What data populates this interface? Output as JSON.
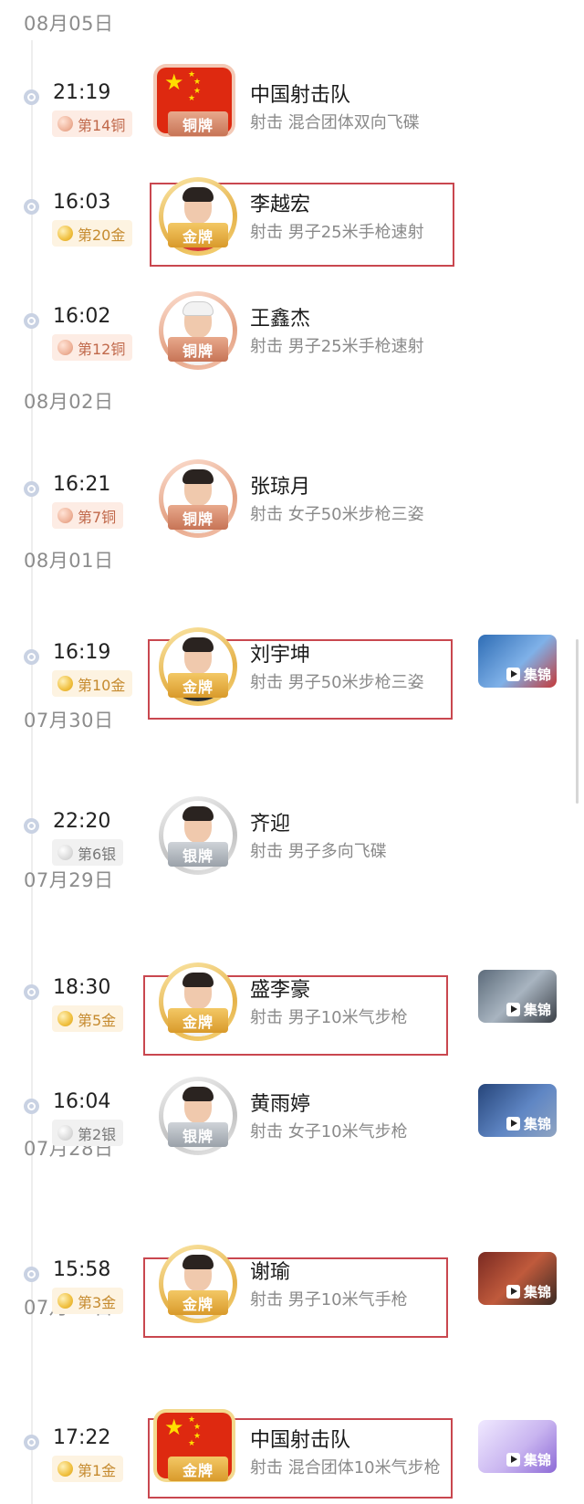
{
  "dates": [
    "08月05日",
    "08月02日",
    "08月01日",
    "07月30日",
    "07月29日",
    "07月28日",
    "07月27日"
  ],
  "entries": [
    {
      "time": "21:19",
      "badge": "第14铜",
      "badge_type": "bronze",
      "medal": "铜牌",
      "name": "中国射击队",
      "event": "射击 混合团体双向飞碟",
      "avatar": "china-flag",
      "video": null
    },
    {
      "time": "16:03",
      "badge": "第20金",
      "badge_type": "gold",
      "medal": "金牌",
      "name": "李越宏",
      "event": "射击 男子25米手枪速射",
      "avatar": "athlete-photo",
      "video": null
    },
    {
      "time": "16:02",
      "badge": "第12铜",
      "badge_type": "bronze",
      "medal": "铜牌",
      "name": "王鑫杰",
      "event": "射击 男子25米手枪速射",
      "avatar": "athlete-photo",
      "video": null
    },
    {
      "time": "16:21",
      "badge": "第7铜",
      "badge_type": "bronze",
      "medal": "铜牌",
      "name": "张琼月",
      "event": "射击 女子50米步枪三姿",
      "avatar": "athlete-photo",
      "video": null
    },
    {
      "time": "16:19",
      "badge": "第10金",
      "badge_type": "gold",
      "medal": "金牌",
      "name": "刘宇坤",
      "event": "射击 男子50米步枪三姿",
      "avatar": "athlete-photo",
      "video": "集锦"
    },
    {
      "time": "22:20",
      "badge": "第6银",
      "badge_type": "silver",
      "medal": "银牌",
      "name": "齐迎",
      "event": "射击 男子多向飞碟",
      "avatar": "athlete-photo",
      "video": null
    },
    {
      "time": "18:30",
      "badge": "第5金",
      "badge_type": "gold",
      "medal": "金牌",
      "name": "盛李豪",
      "event": "射击 男子10米气步枪",
      "avatar": "athlete-photo",
      "video": "集锦"
    },
    {
      "time": "16:04",
      "badge": "第2银",
      "badge_type": "silver",
      "medal": "银牌",
      "name": "黄雨婷",
      "event": "射击 女子10米气步枪",
      "avatar": "athlete-photo",
      "video": "集锦"
    },
    {
      "time": "15:58",
      "badge": "第3金",
      "badge_type": "gold",
      "medal": "金牌",
      "name": "谢瑜",
      "event": "射击 男子10米气手枪",
      "avatar": "athlete-photo",
      "video": "集锦"
    },
    {
      "time": "17:22",
      "badge": "第1金",
      "badge_type": "gold",
      "medal": "金牌",
      "name": "中国射击队",
      "event": "射击 混合团体10米气步枪",
      "avatar": "china-flag",
      "video": "集锦"
    }
  ]
}
